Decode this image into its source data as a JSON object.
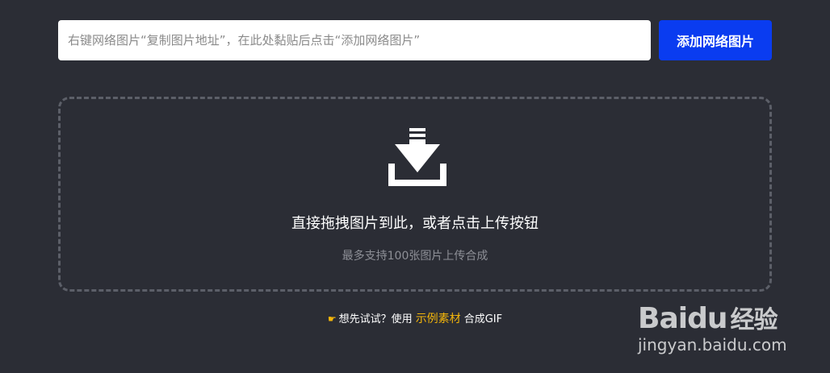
{
  "url_bar": {
    "placeholder": "右键网络图片“复制图片地址”，在此处黏贴后点击“添加网络图片”",
    "add_button_label": "添加网络图片"
  },
  "dropzone": {
    "icon": "download-tray-icon",
    "title": "直接拖拽图片到此，或者点击上传按钮",
    "subtitle": "最多支持100张图片上传合成"
  },
  "try_line": {
    "icon": "pointing-hand-icon",
    "prefix": "想先试试？使用",
    "link": "示例素材",
    "suffix": "合成GIF"
  },
  "watermark": {
    "brand": "Bai",
    "brand_du": "du",
    "brand_cn": "经验",
    "url": "jingyan.baidu.com"
  },
  "colors": {
    "background": "#2b2d35",
    "button": "#0a3cf0",
    "accent": "#f5b60a",
    "dash_border": "#5c5f68"
  }
}
